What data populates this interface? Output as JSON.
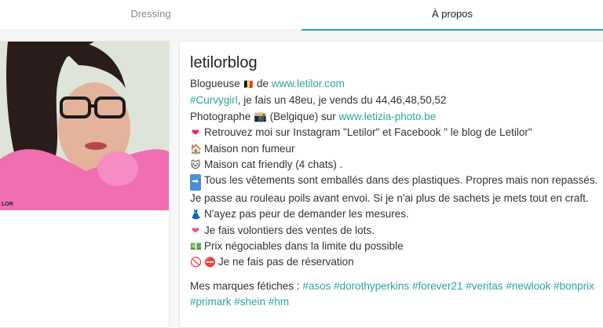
{
  "tabs": [
    {
      "label": "Dressing",
      "active": false
    },
    {
      "label": "À propos",
      "active": true
    }
  ],
  "profile": {
    "photo_label": "LOR",
    "username": "letilorblog"
  },
  "bio": {
    "line1_prefix": "Blogueuse",
    "line1_mid": "de",
    "line1_link": "www.letilor.com",
    "line2_link": "#Curvygirl",
    "line2_text": ", je fais un 48eu, je vends du 44,46,48,50,52",
    "line3_prefix": "Photographe",
    "line3_mid": "(Belgique) sur",
    "line3_link": "www.letizia-photo.be",
    "line4": "Retrouvez moi sur Instagram \"Letilor\" et Facebook \" le blog de Letilor\"",
    "line5": "Maison non fumeur",
    "line6": "Maison cat friendly (4 chats) .",
    "line7": "Tous les vêtements sont emballés dans des plastiques. Propres mais non repassés. Je passe au rouleau poils avant envoi. Si je n'ai plus de sachets je mets tout en craft.",
    "line8": "N'ayez pas peur de demander les mesures.",
    "line9": "Je fais volontiers des ventes de lots.",
    "line10": "Prix négociables dans la limite du possible",
    "line11": "Je ne fais pas de réservation",
    "brands_label": "Mes marques fétiches :",
    "brands": [
      "#asos",
      "#dorothyperkins",
      "#forever21",
      "#veritas",
      "#newlook",
      "#bonprix",
      "#primark",
      "#shein",
      "#hm"
    ]
  },
  "icons": {
    "flag": "belgium-flag-icon",
    "camera": "camera-flash-icon",
    "heart": "red-heart-icon",
    "house": "house-icon",
    "cat": "cat-icon",
    "arrow": "right-arrow-icon",
    "dress": "dress-icon",
    "heart_pink": "pink-heart-icon",
    "money": "banknote-icon",
    "prohibited": "prohibited-icon",
    "no_entry": "no-entry-icon"
  },
  "colors": {
    "accent": "#2ba6a2"
  }
}
